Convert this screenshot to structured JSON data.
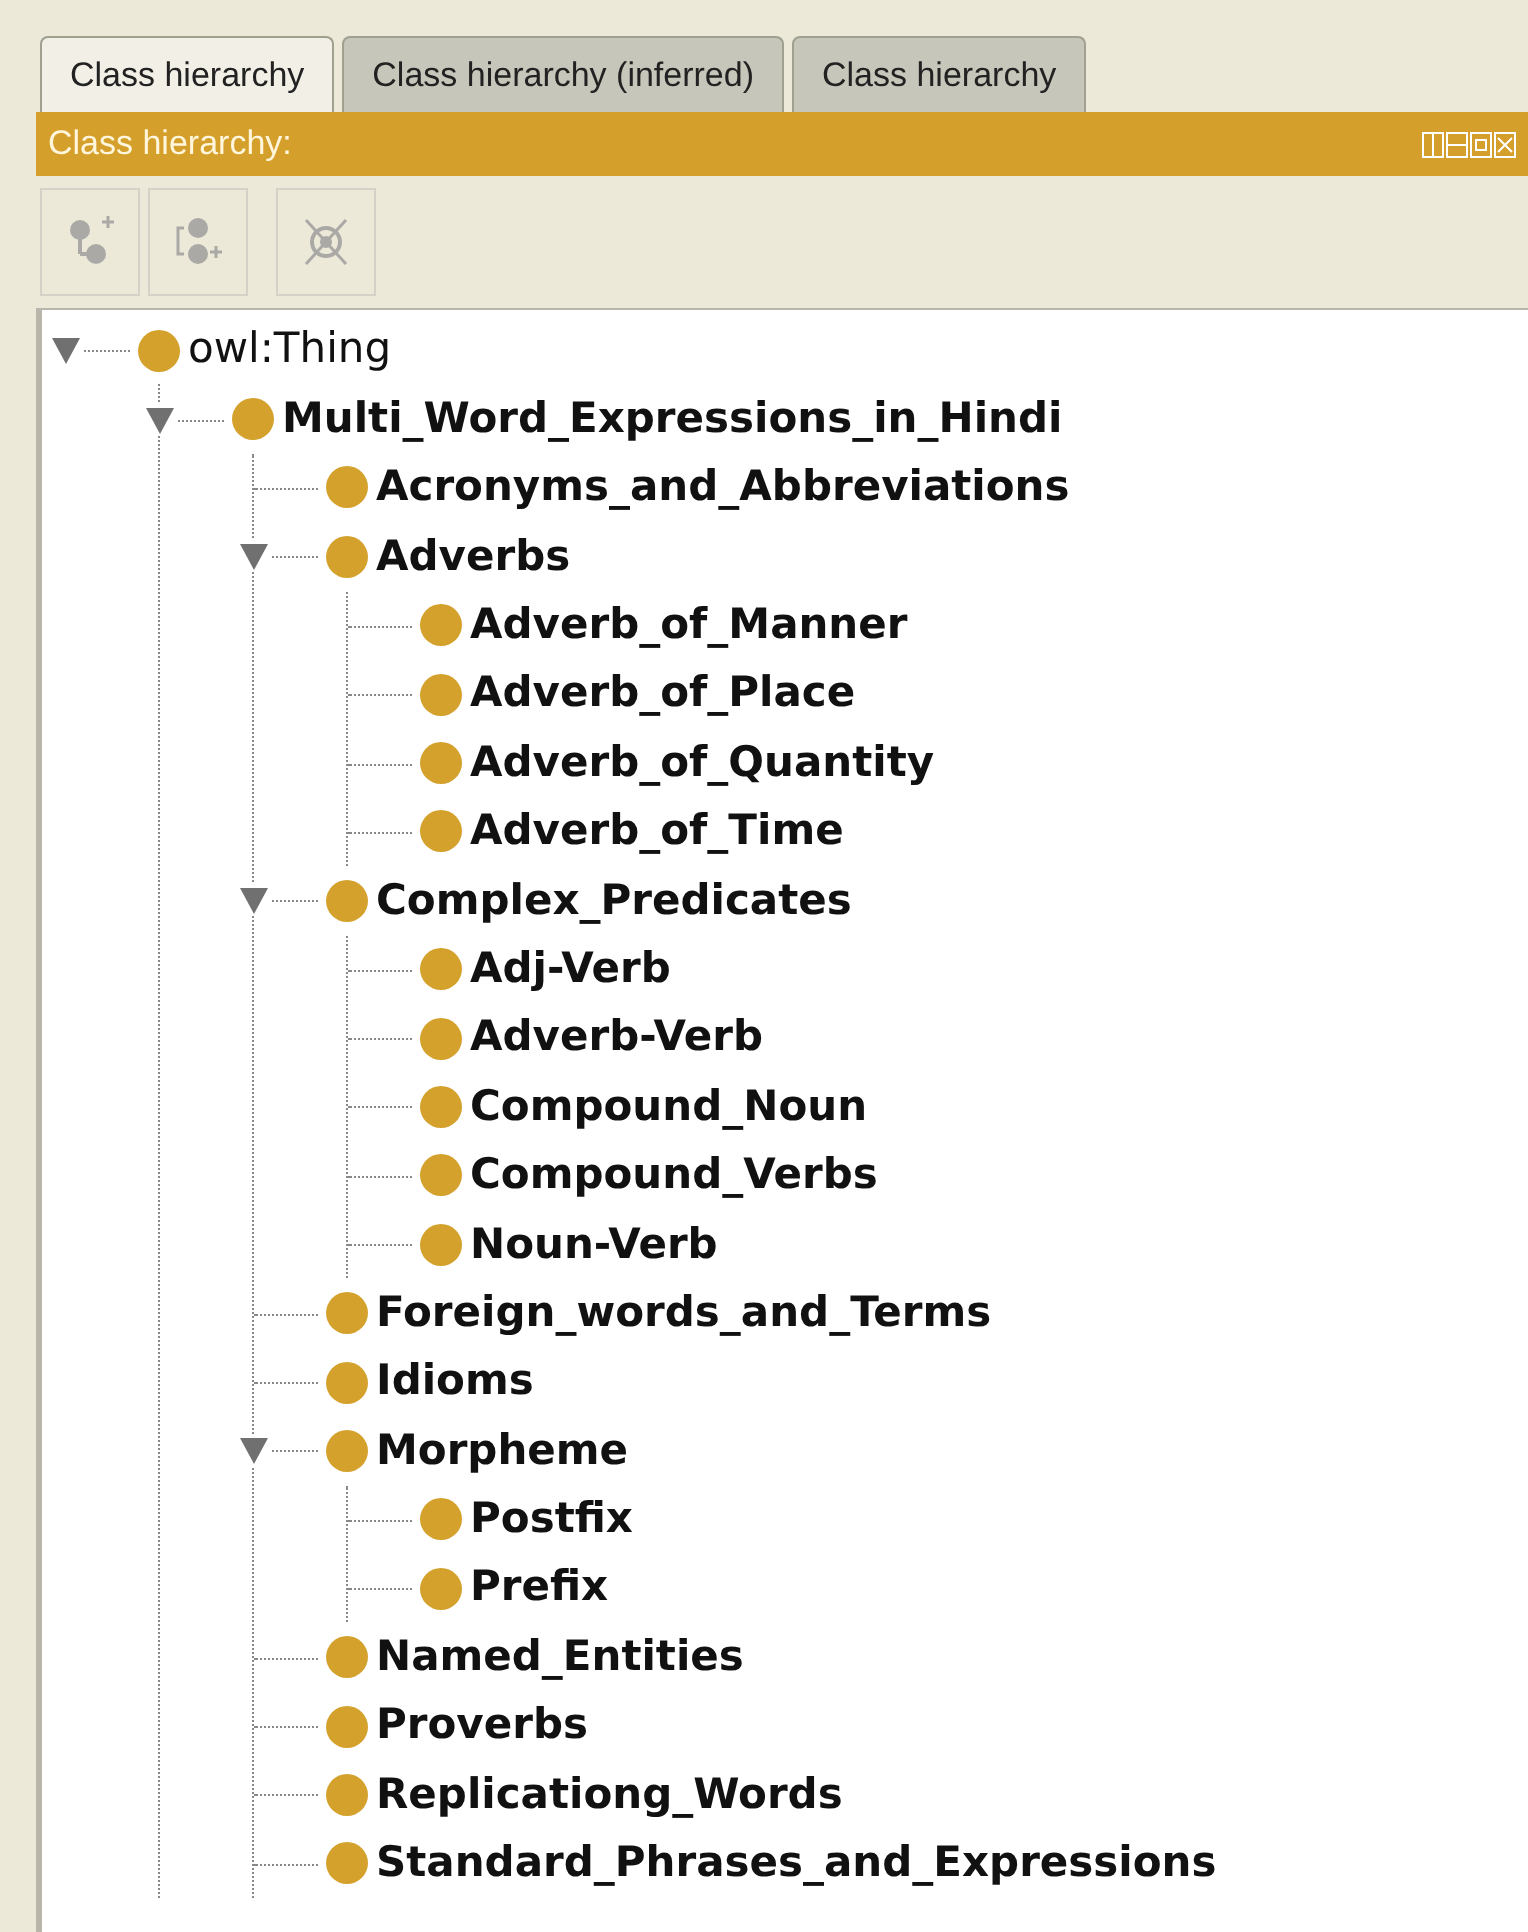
{
  "tabs": [
    {
      "label": "Class hierarchy",
      "selected": true
    },
    {
      "label": "Class hierarchy (inferred)",
      "selected": false
    },
    {
      "label": "Class hierarchy",
      "selected": false
    }
  ],
  "panel": {
    "title": "Class hierarchy:"
  },
  "toolbar": [
    {
      "kind": "add-subclass",
      "disabled": true
    },
    {
      "kind": "add-sibling",
      "disabled": true
    },
    {
      "kind": "delete",
      "disabled": true
    }
  ],
  "tree": [
    {
      "label": "owl:Thing",
      "kind": "root",
      "expanded": true,
      "children": [
        {
          "label": "Multi_Word_Expressions_in_Hindi",
          "kind": "class",
          "expanded": true,
          "children": [
            {
              "label": "Acronyms_and_Abbreviations",
              "kind": "class"
            },
            {
              "label": "Adverbs",
              "kind": "class",
              "expanded": true,
              "children": [
                {
                  "label": "Adverb_of_Manner",
                  "kind": "class"
                },
                {
                  "label": "Adverb_of_Place",
                  "kind": "class"
                },
                {
                  "label": "Adverb_of_Quantity",
                  "kind": "class"
                },
                {
                  "label": "Adverb_of_Time",
                  "kind": "class"
                }
              ]
            },
            {
              "label": "Complex_Predicates",
              "kind": "class",
              "expanded": true,
              "children": [
                {
                  "label": "Adj-Verb",
                  "kind": "class"
                },
                {
                  "label": "Adverb-Verb",
                  "kind": "class"
                },
                {
                  "label": "Compound_Noun",
                  "kind": "class"
                },
                {
                  "label": "Compound_Verbs",
                  "kind": "class"
                },
                {
                  "label": "Noun-Verb",
                  "kind": "class"
                }
              ]
            },
            {
              "label": "Foreign_words_and_Terms",
              "kind": "class"
            },
            {
              "label": "Idioms",
              "kind": "class"
            },
            {
              "label": "Morpheme",
              "kind": "class",
              "expanded": true,
              "children": [
                {
                  "label": "Postfix",
                  "kind": "class"
                },
                {
                  "label": "Prefix",
                  "kind": "class"
                }
              ]
            },
            {
              "label": "Named_Entities",
              "kind": "class"
            },
            {
              "label": "Proverbs",
              "kind": "class"
            },
            {
              "label": "Replicationg_Words",
              "kind": "class"
            },
            {
              "label": "Standard_Phrases_and_Expressions",
              "kind": "class"
            }
          ]
        }
      ]
    }
  ]
}
